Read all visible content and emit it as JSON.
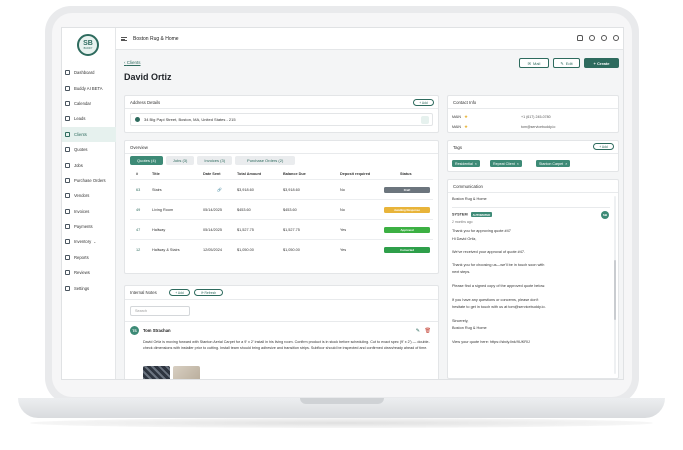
{
  "app": {
    "logo_text": "SB",
    "logo_sub": "BUDDY",
    "company": "Boston Rug & Home"
  },
  "sidebar": {
    "items": [
      {
        "label": "Dashboard",
        "icon": "dashboard-icon"
      },
      {
        "label": "Buddy AI BETA",
        "icon": "sparkle-icon"
      },
      {
        "label": "Calendar",
        "icon": "calendar-icon"
      },
      {
        "label": "Leads",
        "icon": "leads-icon"
      },
      {
        "label": "Clients",
        "icon": "clients-icon",
        "active": true
      },
      {
        "label": "Quotes",
        "icon": "quotes-icon"
      },
      {
        "label": "Jobs",
        "icon": "jobs-icon"
      },
      {
        "label": "Purchase Orders",
        "icon": "purchase-orders-icon"
      },
      {
        "label": "Vendors",
        "icon": "vendors-icon"
      },
      {
        "label": "Invoices",
        "icon": "invoices-icon"
      },
      {
        "label": "Payments",
        "icon": "payments-icon"
      },
      {
        "label": "Inventory",
        "icon": "inventory-icon",
        "caret": "⌄"
      },
      {
        "label": "Reports",
        "icon": "reports-icon"
      },
      {
        "label": "Reviews",
        "icon": "reviews-icon"
      },
      {
        "label": "Settings",
        "icon": "settings-icon"
      }
    ]
  },
  "header": {
    "back_label": "Clients",
    "title": "David Ortiz",
    "mail_label": "Mail",
    "edit_label": "Edit",
    "create_label": "+ Create"
  },
  "address": {
    "title": "Address Details",
    "add_label": "+ Add",
    "text": "34 Big Papi Street, Boston, MA, United States - 215"
  },
  "overview": {
    "title": "Overview",
    "tabs": [
      "Quotes (4)",
      "Jobs (3)",
      "Invoices (3)",
      "Purchase Orders (2)"
    ],
    "columns": [
      "#",
      "Title",
      "Date Sent",
      "Total Amount",
      "Balance Due",
      "Deposit required",
      "Status"
    ],
    "rows": [
      {
        "num": "63",
        "title": "Stairs",
        "date": "🔗",
        "total": "$3,918.60",
        "balance": "$3,918.60",
        "deposit": "No",
        "status": "Draft",
        "color": "#6c757d"
      },
      {
        "num": "49",
        "title": "Living Room",
        "date": "05/14/2025",
        "total": "$453.60",
        "balance": "$453.60",
        "deposit": "No",
        "status": "Awaiting Response",
        "color": "#e8b43a"
      },
      {
        "num": "47",
        "title": "Hallway",
        "date": "05/14/2025",
        "total": "$1,527.75",
        "balance": "$1,527.75",
        "deposit": "Yes",
        "status": "Approved",
        "color": "#3cb043"
      },
      {
        "num": "12",
        "title": "Hallway & Stairs",
        "date": "12/05/2024",
        "total": "$1,050.00",
        "balance": "$1,050.00",
        "deposit": "Yes",
        "status": "Converted",
        "color": "#2e9f4a"
      }
    ]
  },
  "notes": {
    "title": "Internal Notes",
    "add_label": "+ Add",
    "refresh_label": "⟳ Refresh",
    "search_placeholder": "Search",
    "author_initials": "TS",
    "author": "Tom Strachan",
    "text": "David Ortiz is moving forward with Stanton Aerial Carpet for a 9' x 2' install in his living room. Confirm product is in stock before scheduling. Cut to exact spec (9' x 2') — double-check dimensions with installer prior to cutting. Install team should bring adhesive and transition strips. Subfloor should be inspected and confirmed clean/ready ahead of time."
  },
  "contact": {
    "title": "Contact Info",
    "rows": [
      {
        "type": "MAIN",
        "value": "+1 (617) 245-0780"
      },
      {
        "type": "MAIN",
        "value": "tom@servicebuddy.io"
      }
    ]
  },
  "tags": {
    "title": "Tags",
    "add_label": "+ Add",
    "items": [
      "Residential",
      "Repeat Client",
      "Stanton Carpet"
    ]
  },
  "communication": {
    "title": "Communication",
    "subject": "Boston Rug & Home",
    "sender": "SYSTEM",
    "badge": "AUTOMATED",
    "avatar": "SB",
    "time": "2 months ago",
    "lines": [
      "Thank you for approving quote #47",
      "Hi David Ortiz,",
      "We've received your approval of quote #47.",
      "Thank you for choosing us—we'll be in touch soon with",
      "next steps.",
      "Please find a signed copy of the approved quote below.",
      "If you have any questions or concerns, please don't",
      "hesitate to get in touch with us at tom@servicebuddy.io.",
      "Sincerely,",
      "Boston Rug & Home",
      "View your quote here: https://sbdy.link/9UKRlJ"
    ]
  }
}
